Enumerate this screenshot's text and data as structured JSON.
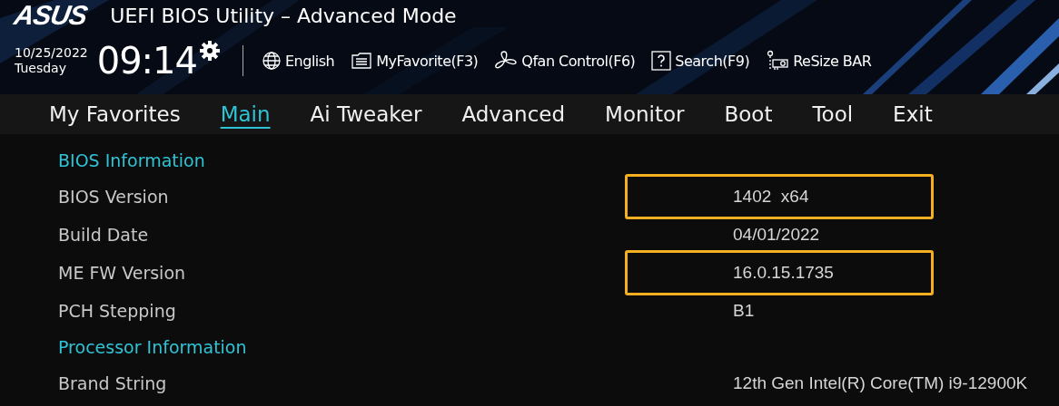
{
  "header": {
    "logo": "ASUS",
    "title": "UEFI BIOS Utility – Advanced Mode",
    "date": "10/25/2022",
    "day": "Tuesday",
    "time": "09:14",
    "tools": [
      {
        "kind": "globe",
        "label": "English"
      },
      {
        "kind": "favorite",
        "label": "MyFavorite(F3)"
      },
      {
        "kind": "fan",
        "label": "Qfan Control(F6)"
      },
      {
        "kind": "search",
        "label": "Search(F9)"
      },
      {
        "kind": "resize",
        "label": "ReSize BAR"
      }
    ]
  },
  "tabs": [
    {
      "label": "My Favorites",
      "selected": false
    },
    {
      "label": "Main",
      "selected": true
    },
    {
      "label": "Ai Tweaker",
      "selected": false
    },
    {
      "label": "Advanced",
      "selected": false
    },
    {
      "label": "Monitor",
      "selected": false
    },
    {
      "label": "Boot",
      "selected": false
    },
    {
      "label": "Tool",
      "selected": false
    },
    {
      "label": "Exit",
      "selected": false
    }
  ],
  "rows": [
    {
      "kind": "section",
      "label": "BIOS Information"
    },
    {
      "kind": "item",
      "label": "BIOS Version",
      "value": "1402  x64",
      "highlighted": true
    },
    {
      "kind": "item",
      "label": "Build Date",
      "value": "04/01/2022",
      "highlighted": false
    },
    {
      "kind": "item",
      "label": "ME FW Version",
      "value": "16.0.15.1735",
      "highlighted": true
    },
    {
      "kind": "item",
      "label": "PCH Stepping",
      "value": "B1",
      "highlighted": false
    },
    {
      "kind": "section",
      "label": "Processor Information"
    },
    {
      "kind": "item",
      "label": "Brand String",
      "value": "12th Gen Intel(R) Core(TM) i9-12900K",
      "highlighted": false
    }
  ]
}
